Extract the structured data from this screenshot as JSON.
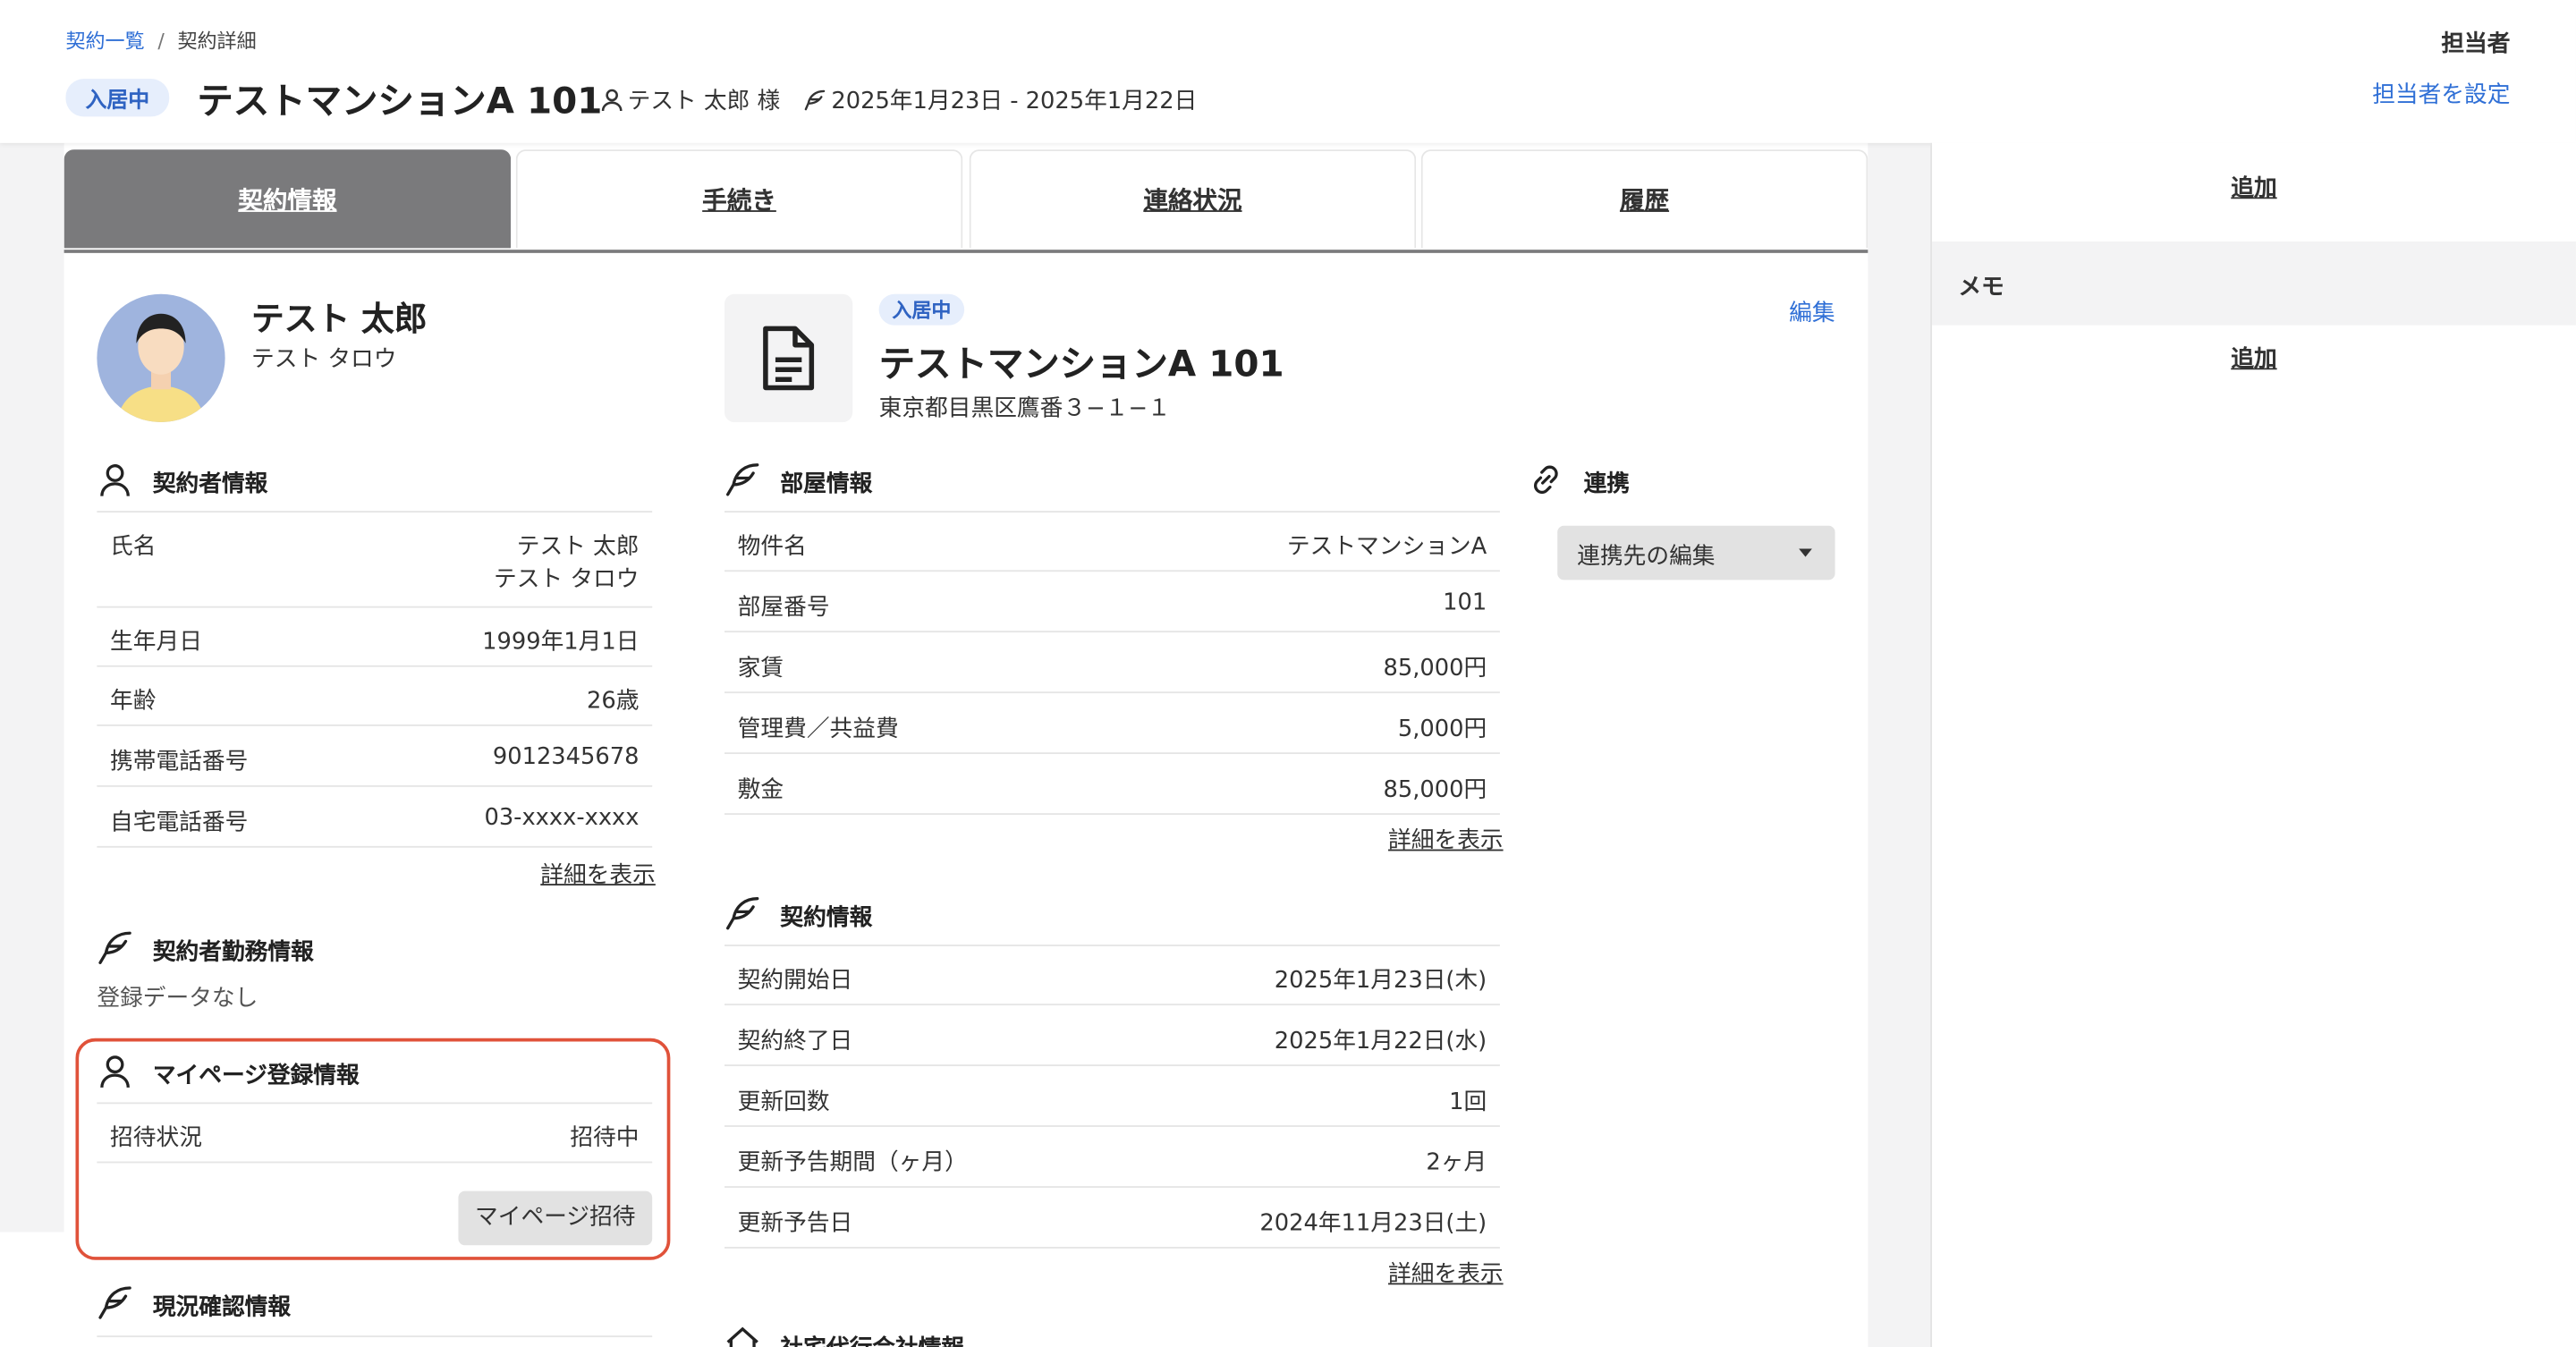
{
  "breadcrumb": {
    "link": "契約一覧",
    "separator": "/",
    "current": "契約詳細"
  },
  "header": {
    "status": "入居中",
    "title": "テストマンションA 101",
    "tenant": "テスト 太郎 様",
    "period": "2025年1月23日 - 2025年1月22日",
    "assignee_label": "担当者",
    "assignee_link": "担当者を設定"
  },
  "tabs": [
    {
      "label": "契約情報",
      "active": true
    },
    {
      "label": "手続き",
      "active": false
    },
    {
      "label": "連絡状況",
      "active": false
    },
    {
      "label": "履歴",
      "active": false
    }
  ],
  "person": {
    "name": "テスト 太郎",
    "kana": "テスト タロウ",
    "contractor_section": "契約者情報",
    "rows": [
      {
        "label": "氏名",
        "value": "テスト 太郎",
        "value2": "テスト タロウ"
      },
      {
        "label": "生年月日",
        "value": "1999年1月1日"
      },
      {
        "label": "年齢",
        "value": "26歳"
      },
      {
        "label": "携帯電話番号",
        "value": "9012345678"
      },
      {
        "label": "自宅電話番号",
        "value": "03-xxxx-xxxx"
      }
    ],
    "details_link": "詳細を表示",
    "work_section": "契約者勤務情報",
    "work_empty": "登録データなし",
    "mypage_section": "マイページ登録情報",
    "mypage_rows": [
      {
        "label": "招待状況",
        "value": "招待中"
      }
    ],
    "mypage_button": "マイページ招待",
    "status_section": "現況確認情報"
  },
  "property": {
    "status": "入居中",
    "title": "テストマンションA 101",
    "address": "東京都目黒区鷹番３−１−１",
    "edit": "編集",
    "room_section": "部屋情報",
    "room_rows": [
      {
        "label": "物件名",
        "value": "テストマンションA"
      },
      {
        "label": "部屋番号",
        "value": "101"
      },
      {
        "label": "家賃",
        "value": "85,000円"
      },
      {
        "label": "管理費／共益費",
        "value": "5,000円"
      },
      {
        "label": "敷金",
        "value": "85,000円"
      }
    ],
    "room_details": "詳細を表示",
    "contract_section": "契約情報",
    "contract_rows": [
      {
        "label": "契約開始日",
        "value": "2025年1月23日(木)"
      },
      {
        "label": "契約終了日",
        "value": "2025年1月22日(水)"
      },
      {
        "label": "更新回数",
        "value": "1回"
      },
      {
        "label": "更新予告期間（ヶ月）",
        "value": "2ヶ月"
      },
      {
        "label": "更新予告日",
        "value": "2024年11月23日(土)"
      }
    ],
    "contract_details": "詳細を表示",
    "agency_section": "社宅代行会社情報",
    "link_section": "連携",
    "link_select": "連携先の編集"
  },
  "right_panel": {
    "add_top": "追加",
    "memo": "メモ",
    "add_memo": "追加"
  },
  "colors": {
    "accent": "#2f6fd6",
    "tab_active": "#7a7a7c",
    "highlight": "#e0523a",
    "status_bg": "#e6eefc"
  }
}
